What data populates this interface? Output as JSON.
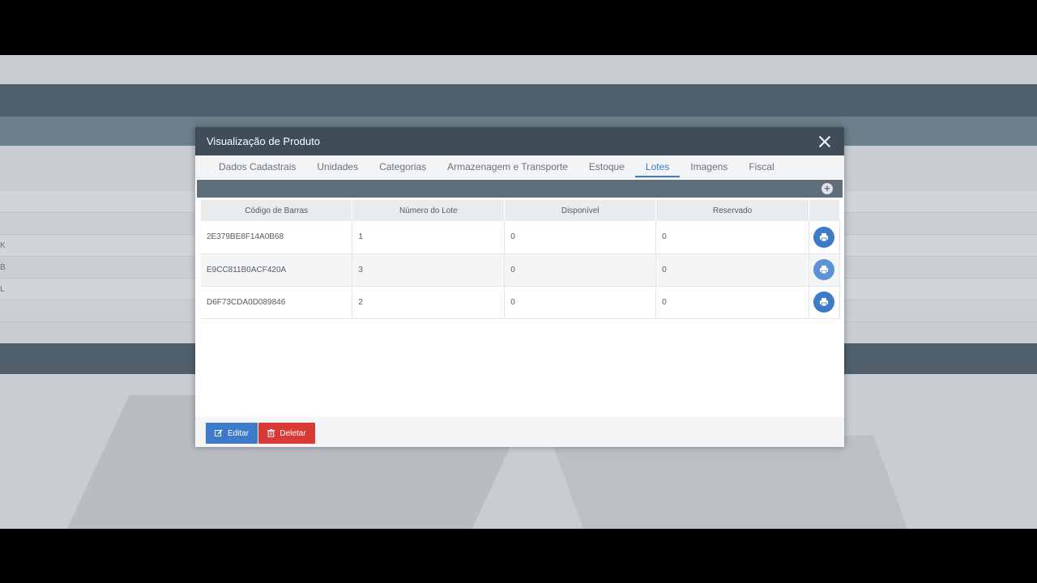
{
  "modal": {
    "title": "Visualização de Produto"
  },
  "tabs": [
    {
      "label": "Dados Cadastrais"
    },
    {
      "label": "Unidades"
    },
    {
      "label": "Categorias"
    },
    {
      "label": "Armazenagem e Transporte"
    },
    {
      "label": "Estoque"
    },
    {
      "label": "Lotes",
      "active": true
    },
    {
      "label": "Imagens"
    },
    {
      "label": "Fiscal"
    }
  ],
  "table": {
    "headers": [
      "Código de Barras",
      "Número do Lote",
      "Disponível",
      "Reservado"
    ],
    "rows": [
      {
        "barcode": "2E379BE8F14A0B68",
        "lot": "1",
        "available": "0",
        "reserved": "0"
      },
      {
        "barcode": "E9CC811B0ACF420A",
        "lot": "3",
        "available": "0",
        "reserved": "0"
      },
      {
        "barcode": "D6F73CDA0D089846",
        "lot": "2",
        "available": "0",
        "reserved": "0"
      }
    ]
  },
  "footer": {
    "edit_label": "Editar",
    "delete_label": "Deletar"
  },
  "background": {
    "fragments": [
      "K",
      "B",
      "L"
    ]
  },
  "colors": {
    "accent": "#3d7ac8",
    "danger": "#d93a35",
    "header": "#3f4d58",
    "toolbar": "#5e6e7b"
  },
  "icons": {
    "close": "close-icon",
    "add": "plus-circle-icon",
    "print": "printer-icon",
    "edit": "edit-icon",
    "delete": "trash-icon"
  }
}
